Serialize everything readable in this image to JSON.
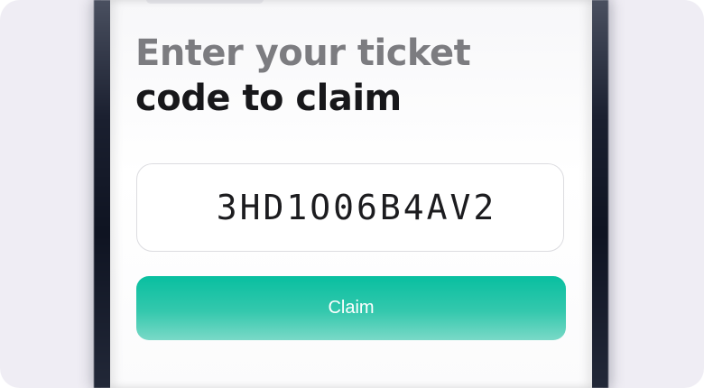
{
  "screen": {
    "headline_line1": "Enter your ticket",
    "headline_line2": "code to claim"
  },
  "code_input": {
    "value": "3HD1O06B4AV2"
  },
  "claim_button": {
    "label": "Claim"
  },
  "colors": {
    "accent": "#08bfa0",
    "headline_muted": "#7c7c80",
    "headline_dark": "#17171a"
  }
}
